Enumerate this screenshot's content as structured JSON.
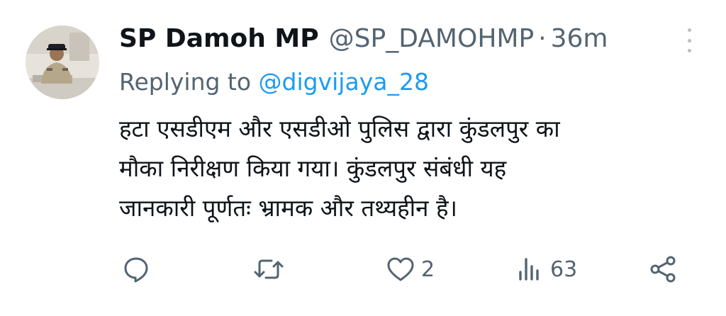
{
  "tweet": {
    "display_name": "SP Damoh MP",
    "handle": "@SP_DAMOHMP",
    "separator": "·",
    "time": "36m",
    "replying_prefix": "Replying to",
    "replying_handle": "@digvijaya_28",
    "body_lines": [
      "हटा एसडीएम और एसडीओ पुलिस द्वारा कुंडलपुर का",
      "मौका निरीक्षण किया गया। कुंडलपुर संबंधी यह",
      "जानकारी पूर्णतः भ्रामक और तथ्यहीन है।"
    ]
  },
  "actions": {
    "reply": {
      "icon": "reply-icon",
      "count": ""
    },
    "retweet": {
      "icon": "retweet-icon",
      "count": ""
    },
    "like": {
      "icon": "heart-icon",
      "count": "2"
    },
    "views": {
      "icon": "views-icon",
      "count": "63"
    },
    "share": {
      "icon": "share-icon"
    }
  },
  "colors": {
    "text": "#0f1419",
    "secondary": "#536471",
    "link": "#1d9bf0"
  }
}
